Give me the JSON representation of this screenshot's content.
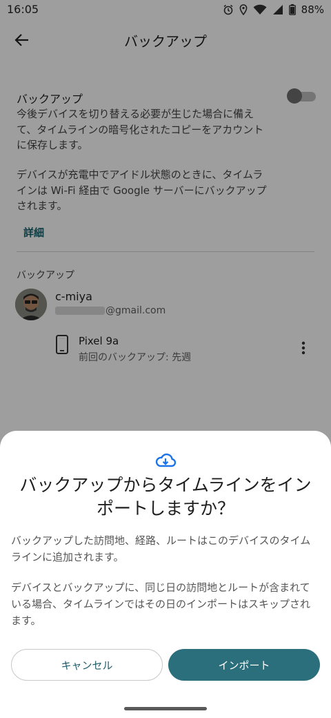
{
  "status_bar": {
    "time": "16:05",
    "battery": "88%",
    "icons": [
      "alarm-icon",
      "location-icon",
      "wifi-icon",
      "signal-icon",
      "battery-icon"
    ]
  },
  "app_bar": {
    "title": "バックアップ",
    "back_icon": "arrow-back-icon"
  },
  "backup_setting": {
    "title": "バックアップ",
    "description": "今後デバイスを切り替える必要が生じた場合に備えて、タイムラインの暗号化されたコピーをアカウントに保存します。",
    "description2": "デバイスが充電中でアイドル状態のときに、タイムラインは Wi-Fi 経由で Google サーバーにバックアップされます。",
    "toggle_on": false,
    "details_link": "詳細"
  },
  "backup_list": {
    "label": "バックアップ",
    "account": {
      "name": "c-miya",
      "email_suffix": "@gmail.com"
    },
    "device": {
      "name": "Pixel 9a",
      "last_backup": "前回のバックアップ: 先週"
    }
  },
  "dialog": {
    "icon": "cloud-download-icon",
    "title": "バックアップからタイムラインをインポートしますか？",
    "paragraph1": "バックアップした訪問地、経路、ルートはこのデバイスのタイムラインに追加されます。",
    "paragraph2": "デバイスとバックアップに、同じ日の訪問地とルートが含まれている場合、タイムラインではその日のインポートはスキップされます。",
    "cancel_label": "キャンセル",
    "import_label": "インポート"
  },
  "colors": {
    "accent": "#2b6f7c",
    "link": "#1a6570",
    "cloud": "#1a73e8"
  }
}
